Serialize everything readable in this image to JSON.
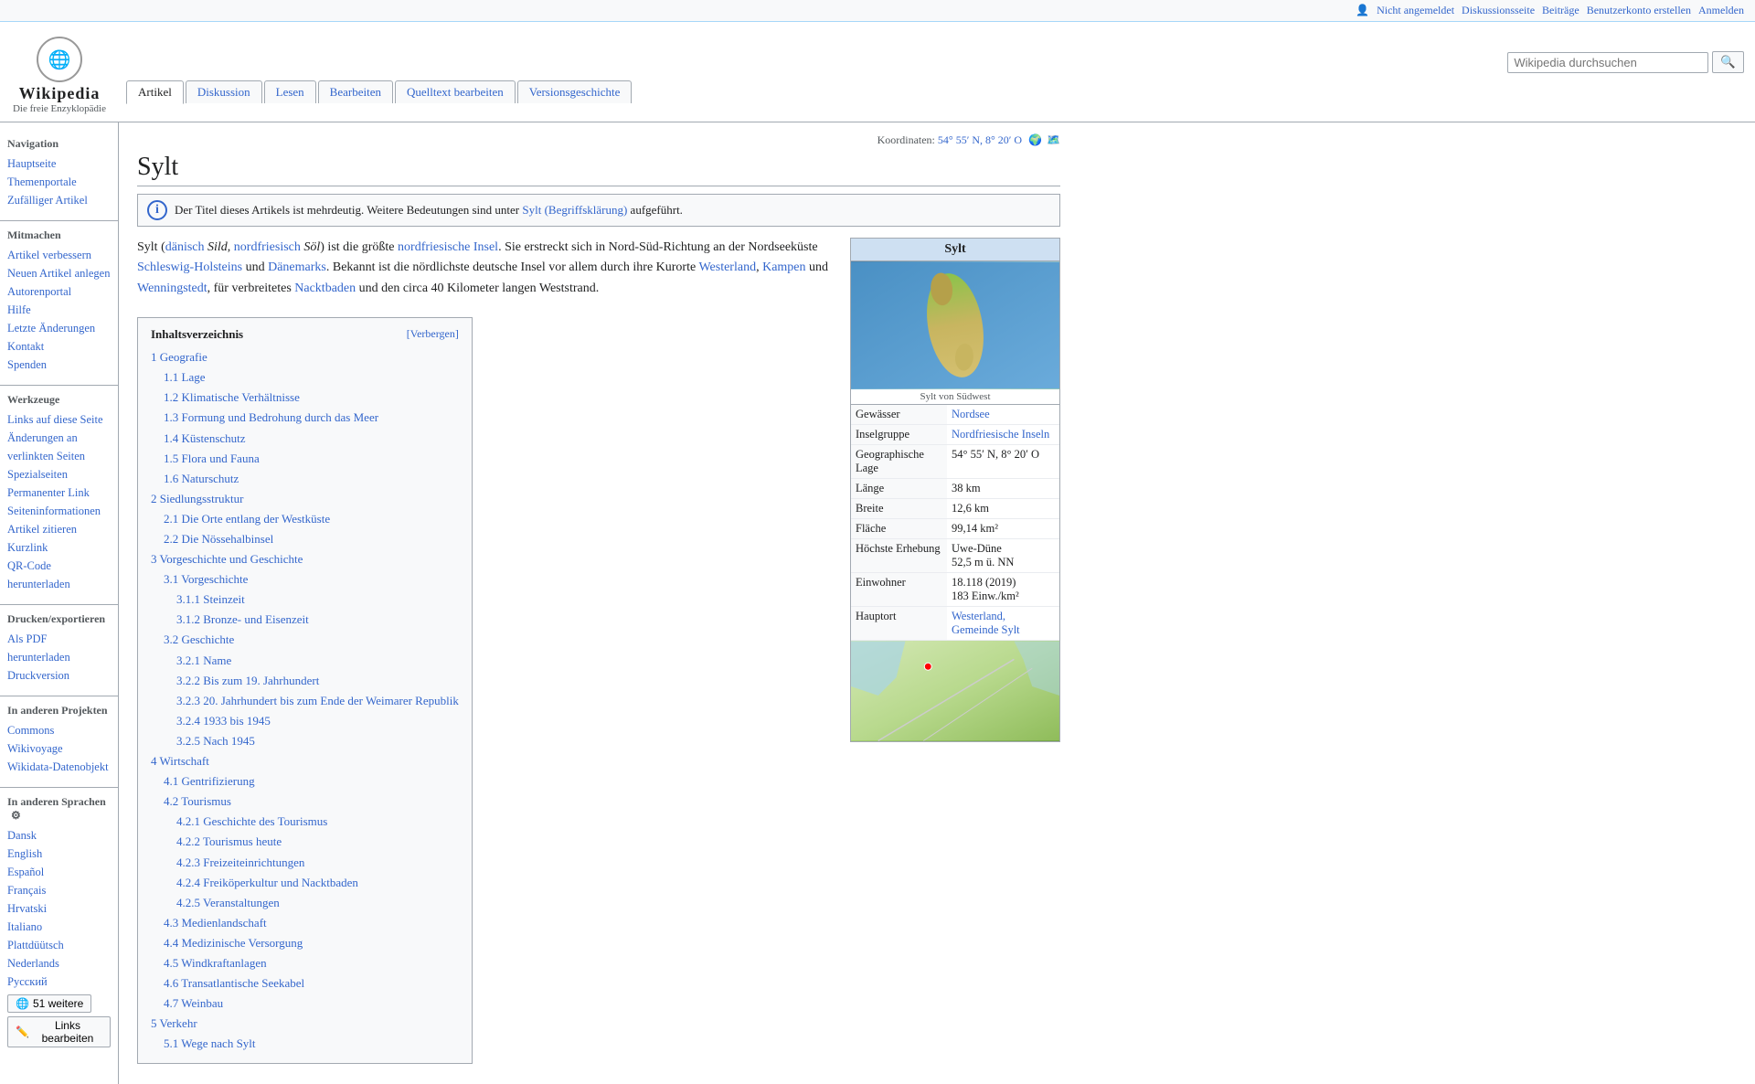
{
  "topbar": {
    "not_logged_in": "Nicht angemeldet",
    "discussion": "Diskussionsseite",
    "contributions": "Beiträge",
    "create_account": "Benutzerkonto erstellen",
    "login": "Anmelden"
  },
  "logo": {
    "title": "Wikipedia",
    "subtitle": "Die freie Enzyklopädie"
  },
  "tabs": {
    "article": "Artikel",
    "discussion": "Diskussion",
    "read": "Lesen",
    "edit": "Bearbeiten",
    "source_edit": "Quelltext bearbeiten",
    "history": "Versionsgeschichte"
  },
  "search": {
    "placeholder": "Wikipedia durchsuchen"
  },
  "coordinates": {
    "label": "Koordinaten:",
    "value": "54° 55′ N, 8° 20′ O"
  },
  "article": {
    "title": "Sylt",
    "disambiguation_text": "Der Titel dieses Artikels ist mehrdeutig. Weitere Bedeutungen sind unter",
    "disambiguation_link": "Sylt (Begriffsklärung)",
    "disambiguation_suffix": "aufgeführt.",
    "intro_p1": "Sylt (dänisch Sild, nordfriesisch Söl) ist die größte nordfriesische Insel. Sie erstreckt sich in Nord-Süd-Richtung an der Nordseeküste Schleswig-Holsteins und Dänemarks. Bekannt ist die nördlichste deutsche Insel vor allem durch ihre Kurorte Westerland, Kampen und Wenningstedt, für verbreitetes Nacktbaden und den circa 40 Kilometer langen Weststrand."
  },
  "toc": {
    "title": "Inhaltsverzeichnis",
    "hide_label": "[Verbergen]",
    "items": [
      {
        "num": "1",
        "label": "Geografie",
        "level": 1
      },
      {
        "num": "1.1",
        "label": "Lage",
        "level": 2
      },
      {
        "num": "1.2",
        "label": "Klimatische Verhältnisse",
        "level": 2
      },
      {
        "num": "1.3",
        "label": "Formung und Bedrohung durch das Meer",
        "level": 2
      },
      {
        "num": "1.4",
        "label": "Küstenschutz",
        "level": 2
      },
      {
        "num": "1.5",
        "label": "Flora und Fauna",
        "level": 2
      },
      {
        "num": "1.6",
        "label": "Naturschutz",
        "level": 2
      },
      {
        "num": "2",
        "label": "Siedlungsstruktur",
        "level": 1
      },
      {
        "num": "2.1",
        "label": "Die Orte entlang der Westküste",
        "level": 2
      },
      {
        "num": "2.2",
        "label": "Die Nössehalbinsel",
        "level": 2
      },
      {
        "num": "3",
        "label": "Vorgeschichte und Geschichte",
        "level": 1
      },
      {
        "num": "3.1",
        "label": "Vorgeschichte",
        "level": 2
      },
      {
        "num": "3.1.1",
        "label": "Steinzeit",
        "level": 3
      },
      {
        "num": "3.1.2",
        "label": "Bronze- und Eisenzeit",
        "level": 3
      },
      {
        "num": "3.2",
        "label": "Geschichte",
        "level": 2
      },
      {
        "num": "3.2.1",
        "label": "Name",
        "level": 3
      },
      {
        "num": "3.2.2",
        "label": "Bis zum 19. Jahrhundert",
        "level": 3
      },
      {
        "num": "3.2.3",
        "label": "20. Jahrhundert bis zum Ende der Weimarer Republik",
        "level": 3
      },
      {
        "num": "3.2.4",
        "label": "1933 bis 1945",
        "level": 3
      },
      {
        "num": "3.2.5",
        "label": "Nach 1945",
        "level": 3
      },
      {
        "num": "4",
        "label": "Wirtschaft",
        "level": 1
      },
      {
        "num": "4.1",
        "label": "Gentrifizierung",
        "level": 2
      },
      {
        "num": "4.2",
        "label": "Tourismus",
        "level": 2
      },
      {
        "num": "4.2.1",
        "label": "Geschichte des Tourismus",
        "level": 3
      },
      {
        "num": "4.2.2",
        "label": "Tourismus heute",
        "level": 3
      },
      {
        "num": "4.2.3",
        "label": "Freizeiteinrichtungen",
        "level": 3
      },
      {
        "num": "4.2.4",
        "label": "Freiköperkultur und Nacktbaden",
        "level": 3
      },
      {
        "num": "4.2.5",
        "label": "Veranstaltungen",
        "level": 3
      },
      {
        "num": "4.3",
        "label": "Medienlandschaft",
        "level": 2
      },
      {
        "num": "4.4",
        "label": "Medizinische Versorgung",
        "level": 2
      },
      {
        "num": "4.5",
        "label": "Windkraftanlagen",
        "level": 2
      },
      {
        "num": "4.6",
        "label": "Transatlantische Seekabel",
        "level": 2
      },
      {
        "num": "4.7",
        "label": "Weinbau",
        "level": 2
      },
      {
        "num": "5",
        "label": "Verkehr",
        "level": 1
      },
      {
        "num": "5.1",
        "label": "Wege nach Sylt",
        "level": 2
      }
    ]
  },
  "infobox": {
    "title": "Sylt",
    "image_caption": "Sylt von Südwest",
    "rows": [
      {
        "label": "Gewässer",
        "value": "Nordsee",
        "link": true
      },
      {
        "label": "Inselgruppe",
        "value": "Nordfriesische Inseln",
        "link": true
      },
      {
        "label": "Geographische Lage",
        "value": "54° 55′ N, 8° 20′ O"
      },
      {
        "label": "Länge",
        "value": "38 km"
      },
      {
        "label": "Breite",
        "value": "12,6 km"
      },
      {
        "label": "Fläche",
        "value": "99,14 km²"
      },
      {
        "label": "Höchste Erhebung",
        "value": "Uwe-Düne\n52,5 m ü. NN"
      },
      {
        "label": "Einwohner",
        "value": "18.118 (2019)\n183 Einw./km²"
      },
      {
        "label": "Hauptort",
        "value": "Westerland, Gemeinde Sylt",
        "link": true
      }
    ]
  },
  "sidebar": {
    "nav_section": "Navigation",
    "nav_items": [
      {
        "label": "Hauptseite"
      },
      {
        "label": "Themenportale"
      },
      {
        "label": "Zufälliger Artikel"
      }
    ],
    "participate_section": "Mitmachen",
    "participate_items": [
      {
        "label": "Artikel verbessern"
      },
      {
        "label": "Neuen Artikel anlegen"
      },
      {
        "label": "Autorenportal"
      },
      {
        "label": "Hilfe"
      },
      {
        "label": "Letzte Änderungen"
      },
      {
        "label": "Kontakt"
      },
      {
        "label": "Spenden"
      }
    ],
    "tools_section": "Werkzeuge",
    "tools_items": [
      {
        "label": "Links auf diese Seite"
      },
      {
        "label": "Änderungen an verlinkten Seiten"
      },
      {
        "label": "Spezialseiten"
      },
      {
        "label": "Permanenter Link"
      },
      {
        "label": "Seiteninformationen"
      },
      {
        "label": "Artikel zitieren"
      },
      {
        "label": "Kurzlink"
      },
      {
        "label": "QR-Code herunterladen"
      }
    ],
    "print_section": "Drucken/exportieren",
    "print_items": [
      {
        "label": "Als PDF herunterladen"
      },
      {
        "label": "Druckversion"
      }
    ],
    "other_projects_section": "In anderen Projekten",
    "other_projects_items": [
      {
        "label": "Commons"
      },
      {
        "label": "Wikivoyage"
      },
      {
        "label": "Wikidata-Datenobjekt"
      }
    ],
    "languages_section": "In anderen Sprachen",
    "languages_settings_icon": "⚙",
    "language_items": [
      {
        "label": "Dansk"
      },
      {
        "label": "English"
      },
      {
        "label": "Español"
      },
      {
        "label": "Français"
      },
      {
        "label": "Hrvatski"
      },
      {
        "label": "Italiano"
      },
      {
        "label": "Plattdüütsch"
      },
      {
        "label": "Nederlands"
      },
      {
        "label": "Русский"
      }
    ],
    "more_languages_btn": "51 weitere",
    "edit_links_btn": "Links bearbeiten"
  }
}
